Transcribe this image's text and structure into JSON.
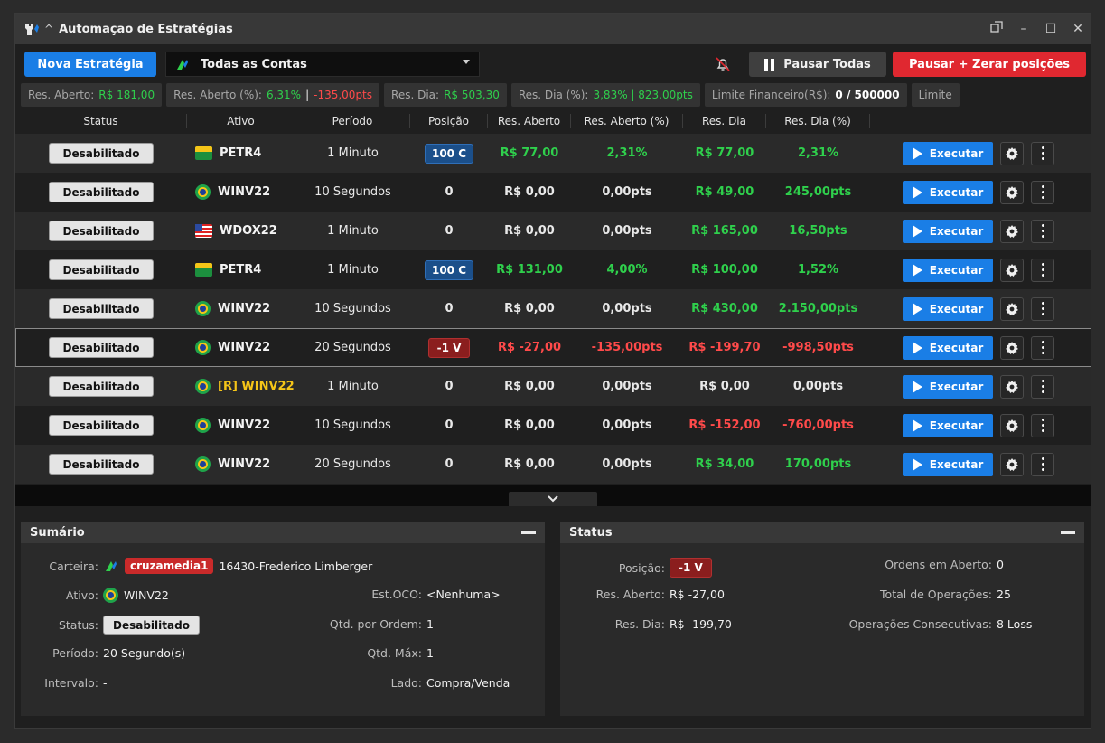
{
  "window": {
    "title": "Automação de Estratégias"
  },
  "toolbar": {
    "new_strategy": "Nova Estratégia",
    "accounts": "Todas as Contas",
    "pause_all": "Pausar Todas",
    "pause_zero": "Pausar + Zerar posições"
  },
  "stats": {
    "res_aberto_label": "Res. Aberto:",
    "res_aberto_value": "R$ 181,00",
    "res_aberto_pct_label": "Res. Aberto (%):",
    "res_aberto_pct_value": "6,31%",
    "res_aberto_pct_sep": "|",
    "res_aberto_pts_value": "-135,00pts",
    "res_dia_label": "Res. Dia:",
    "res_dia_value": "R$ 503,30",
    "res_dia_pct_label": "Res. Dia (%):",
    "res_dia_pct_value": "3,83% | 823,00pts",
    "limite_fin_label": "Limite Financeiro(R$):",
    "limite_fin_value": "0 / 500000",
    "limite_label": "Limite"
  },
  "table": {
    "columns": [
      "Status",
      "Ativo",
      "Período",
      "Posição",
      "Res. Aberto",
      "Res. Aberto (%)",
      "Res. Dia",
      "Res. Dia (%)"
    ],
    "execute_label": "Executar",
    "rows": [
      {
        "status": "Desabilitado",
        "flag": "petr",
        "ativo": "PETR4",
        "periodo": "1 Minuto",
        "posicao": "100 C",
        "pos_type": "c",
        "ra": "R$ 77,00",
        "ra_color": "green",
        "rap": "2,31%",
        "rap_color": "green",
        "rd": "R$ 77,00",
        "rd_color": "green",
        "rdp": "2,31%",
        "rdp_color": "green"
      },
      {
        "status": "Desabilitado",
        "flag": "br",
        "ativo": "WINV22",
        "periodo": "10 Segundos",
        "posicao": "0",
        "pos_type": "plain",
        "ra": "R$ 0,00",
        "ra_color": "white",
        "rap": "0,00pts",
        "rap_color": "white",
        "rd": "R$ 49,00",
        "rd_color": "green",
        "rdp": "245,00pts",
        "rdp_color": "green"
      },
      {
        "status": "Desabilitado",
        "flag": "us",
        "ativo": "WDOX22",
        "periodo": "1 Minuto",
        "posicao": "0",
        "pos_type": "plain",
        "ra": "R$ 0,00",
        "ra_color": "white",
        "rap": "0,00pts",
        "rap_color": "white",
        "rd": "R$ 165,00",
        "rd_color": "green",
        "rdp": "16,50pts",
        "rdp_color": "green"
      },
      {
        "status": "Desabilitado",
        "flag": "petr",
        "ativo": "PETR4",
        "periodo": "1 Minuto",
        "posicao": "100 C",
        "pos_type": "c",
        "ra": "R$ 131,00",
        "ra_color": "green",
        "rap": "4,00%",
        "rap_color": "green",
        "rd": "R$ 100,00",
        "rd_color": "green",
        "rdp": "1,52%",
        "rdp_color": "green"
      },
      {
        "status": "Desabilitado",
        "flag": "br",
        "ativo": "WINV22",
        "periodo": "10 Segundos",
        "posicao": "0",
        "pos_type": "plain",
        "ra": "R$ 0,00",
        "ra_color": "white",
        "rap": "0,00pts",
        "rap_color": "white",
        "rd": "R$ 430,00",
        "rd_color": "green",
        "rdp": "2.150,00pts",
        "rdp_color": "green"
      },
      {
        "status": "Desabilitado",
        "flag": "br",
        "ativo": "WINV22",
        "periodo": "20 Segundos",
        "posicao": "-1 V",
        "pos_type": "v",
        "ra": "R$ -27,00",
        "ra_color": "red",
        "rap": "-135,00pts",
        "rap_color": "red",
        "rd": "R$ -199,70",
        "rd_color": "red",
        "rdp": "-998,50pts",
        "rdp_color": "red",
        "selected": true
      },
      {
        "status": "Desabilitado",
        "flag": "br",
        "ativo": "[R] WINV22",
        "ativo_color": "yellow",
        "periodo": "1 Minuto",
        "posicao": "0",
        "pos_type": "plain",
        "ra": "R$ 0,00",
        "ra_color": "white",
        "rap": "0,00pts",
        "rap_color": "white",
        "rd": "R$ 0,00",
        "rd_color": "white",
        "rdp": "0,00pts",
        "rdp_color": "white"
      },
      {
        "status": "Desabilitado",
        "flag": "br",
        "ativo": "WINV22",
        "periodo": "10 Segundos",
        "posicao": "0",
        "pos_type": "plain",
        "ra": "R$ 0,00",
        "ra_color": "white",
        "rap": "0,00pts",
        "rap_color": "white",
        "rd": "R$ -152,00",
        "rd_color": "red",
        "rdp": "-760,00pts",
        "rdp_color": "red"
      },
      {
        "status": "Desabilitado",
        "flag": "br",
        "ativo": "WINV22",
        "periodo": "20 Segundos",
        "posicao": "0",
        "pos_type": "plain",
        "ra": "R$ 0,00",
        "ra_color": "white",
        "rap": "0,00pts",
        "rap_color": "white",
        "rd": "R$ 34,00",
        "rd_color": "green",
        "rdp": "170,00pts",
        "rdp_color": "green"
      }
    ]
  },
  "sumario": {
    "title": "Sumário",
    "carteira_label": "Carteira:",
    "carteira_badge": "cruzamedia1",
    "carteira_value": "16430-Frederico Limberger",
    "ativo_label": "Ativo:",
    "ativo_value": "WINV22",
    "status_label": "Status:",
    "status_value": "Desabilitado",
    "periodo_label": "Período:",
    "periodo_value": "20 Segundo(s)",
    "intervalo_label": "Intervalo:",
    "intervalo_value": "-",
    "estoco_label": "Est.OCO:",
    "estoco_value": "<Nenhuma>",
    "qtd_ordem_label": "Qtd. por Ordem:",
    "qtd_ordem_value": "1",
    "qtd_max_label": "Qtd. Máx:",
    "qtd_max_value": "1",
    "lado_label": "Lado:",
    "lado_value": "Compra/Venda"
  },
  "status_panel": {
    "title": "Status",
    "posicao_label": "Posição:",
    "posicao_value": "-1 V",
    "res_aberto_label": "Res. Aberto:",
    "res_aberto_value": "R$ -27,00",
    "res_dia_label": "Res. Dia:",
    "res_dia_value": "R$ -199,70",
    "ordens_label": "Ordens em Aberto:",
    "ordens_value": "0",
    "total_ops_label": "Total de Operações:",
    "total_ops_value": "25",
    "consec_label": "Operações Consecutivas:",
    "consec_value": "8 Loss"
  },
  "colors": {
    "accent": "#1a7ee6",
    "danger": "#e02830",
    "profit": "#2fd04c",
    "loss": "#ff4a4a"
  }
}
